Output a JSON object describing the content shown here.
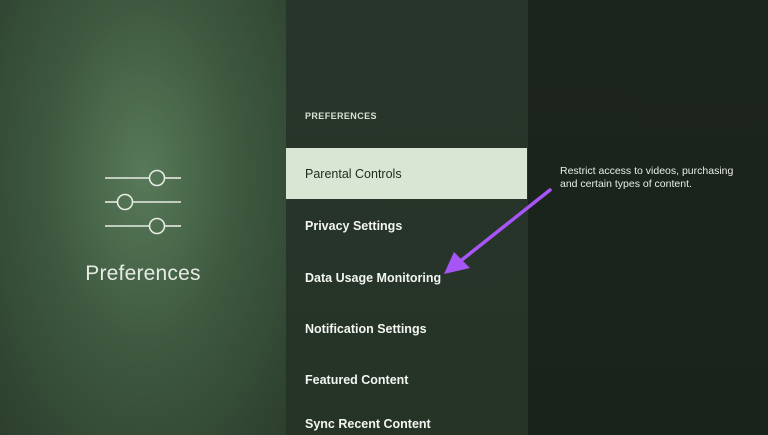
{
  "left_panel": {
    "icon": "sliders-icon",
    "title": "Preferences"
  },
  "menu": {
    "header": "PREFERENCES",
    "items": [
      {
        "label": "Parental Controls",
        "selected": true
      },
      {
        "label": "Privacy Settings",
        "selected": false
      },
      {
        "label": "Data Usage Monitoring",
        "selected": false
      },
      {
        "label": "Notification Settings",
        "selected": false
      },
      {
        "label": "Featured Content",
        "selected": false
      },
      {
        "label": "Sync Recent Content",
        "selected": false
      }
    ]
  },
  "detail": {
    "description": "Restrict access to videos, purchasing and certain types of content."
  },
  "annotation": {
    "icon": "arrow-annotation-icon",
    "color": "#a855f7"
  },
  "colors": {
    "selected_bg": "#d9e6d4",
    "panel_left": "#3f5a40",
    "panel_middle": "#27352a",
    "panel_right": "#1c251d"
  }
}
